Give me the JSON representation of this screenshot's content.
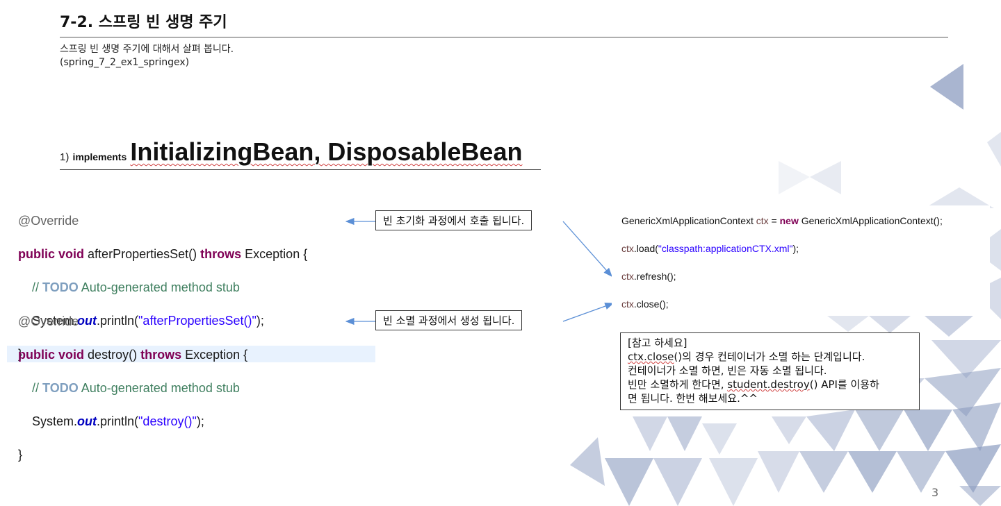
{
  "slide": {
    "title": "7-2. 스프링 빈 생명 주기",
    "subtitle_line1": "스프링 빈 생명 주기에 대해서 살펴 봅니다.",
    "subtitle_line2": "(spring_7_2_ex1_springex)",
    "section_number": "1)",
    "section_keyword": "implements",
    "section_interfaces": "InitializingBean, DisposableBean",
    "page_number": "3"
  },
  "code_block_1": {
    "annotation": "@Override",
    "kw_public": "public",
    "kw_void": "void",
    "method": "afterPropertiesSet()",
    "kw_throws": "throws",
    "exception": "Exception {",
    "comment_prefix": "// ",
    "todo": "TODO",
    "comment_text": " Auto-generated method stub",
    "sys": "System.",
    "out": "out",
    "println": ".println(",
    "string": "\"afterPropertiesSet()\"",
    "close_paren": ");",
    "close_brace": "}"
  },
  "code_block_2": {
    "annotation": "@Override",
    "kw_public": "public",
    "kw_void": "void",
    "method": "destroy()",
    "kw_throws": "throws",
    "exception": "Exception {",
    "comment_prefix": "// ",
    "todo": "TODO",
    "comment_text": " Auto-generated method stub",
    "sys": "System.",
    "out": "out",
    "println": ".println(",
    "string": "\"destroy()\"",
    "close_paren": ");",
    "close_brace": "}"
  },
  "callouts": {
    "init": "빈 초기화 과정에서 호출 됩니다.",
    "destroy": "빈 소멸 과정에서 생성 됩니다."
  },
  "ctx_code": {
    "line1_type": "GenericXmlApplicationContext",
    "line1_var": "ctx",
    "line1_eq": " = ",
    "line1_new": "new",
    "line1_rest": " GenericXmlApplicationContext();",
    "line2_var": "ctx",
    "line2_call": ".load(",
    "line2_str": "\"classpath:applicationCTX.xml\"",
    "line2_end": ");",
    "line3_var": "ctx",
    "line3_call": ".refresh();",
    "line4_var": "ctx",
    "line4_call": ".close();"
  },
  "note": {
    "line1": "[참고 하세요]",
    "line2_code": "ctx.close",
    "line2_rest": "()의 경우 컨테이너가 소멸 하는 단계입니다.",
    "line3": "컨테이너가 소멸 하면, 빈은 자동 소멸 됩니다.",
    "line4_pre": "빈만 소멸하게 한다면, ",
    "line4_code": "student.destroy",
    "line4_rest": "() API를 이용하",
    "line5": "면 됩니다. 한번 해보세요.^^"
  },
  "colors": {
    "keyword": "#7f0055",
    "comment": "#3f7f5f",
    "string": "#2a00ff",
    "static_field": "#0000c0",
    "arrow": "#5b8fd6",
    "triangle_decor": "#9aa9c9"
  }
}
